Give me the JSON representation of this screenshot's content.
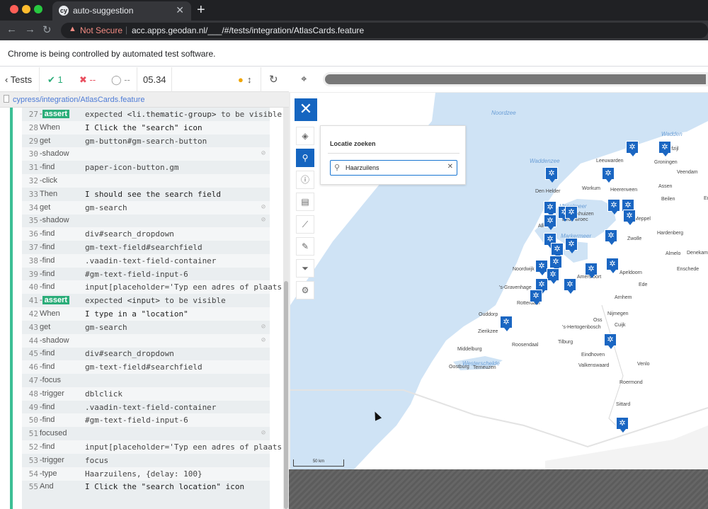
{
  "browser": {
    "tab_title": "auto-suggestion",
    "tab_favicon_text": "cy",
    "security_label": "Not Secure",
    "url": "acc.apps.geodan.nl/___/#/tests/integration/AtlasCards.feature",
    "infobar_text": "Chrome is being controlled by automated test software."
  },
  "reporter": {
    "tests_label": "Tests",
    "passed": "1",
    "failed": "--",
    "pending": "--",
    "duration": "05.34",
    "spec_path": "cypress/integration/AtlasCards.feature",
    "commands": [
      {
        "n": "27",
        "kw": "-assert",
        "msg": "expected <li.thematic-group> to be visible",
        "assert": true,
        "pre": "expected ",
        "el": "<li.thematic-group>",
        "post": " to be ",
        "state": "visible"
      },
      {
        "n": "28",
        "kw": "When",
        "msg": "I Click the \"search\" icon"
      },
      {
        "n": "29",
        "kw": "get",
        "msg": "gm-button#gm-search-button"
      },
      {
        "n": "30",
        "kw": "-shadow",
        "msg": "",
        "eye": true
      },
      {
        "n": "31",
        "kw": "-find",
        "msg": "paper-icon-button.gm"
      },
      {
        "n": "32",
        "kw": "-click",
        "msg": ""
      },
      {
        "n": "33",
        "kw": "Then",
        "msg": "I should see the search field"
      },
      {
        "n": "34",
        "kw": "get",
        "msg": "gm-search",
        "eye": true
      },
      {
        "n": "35",
        "kw": "-shadow",
        "msg": "",
        "eye": true
      },
      {
        "n": "36",
        "kw": "-find",
        "msg": "div#search_dropdown"
      },
      {
        "n": "37",
        "kw": "-find",
        "msg": "gm-text-field#searchfield"
      },
      {
        "n": "38",
        "kw": "-find",
        "msg": ".vaadin-text-field-container"
      },
      {
        "n": "39",
        "kw": "-find",
        "msg": "#gm-text-field-input-6"
      },
      {
        "n": "40",
        "kw": "-find",
        "msg": "input[placeholder='Typ een adres of plaats']"
      },
      {
        "n": "41",
        "kw": "-assert",
        "msg": "expected <input> to be visible",
        "assert": true,
        "pre": "expected ",
        "el": "<input>",
        "post": " to be ",
        "state": "visible"
      },
      {
        "n": "42",
        "kw": "When",
        "msg": "I type in a \"location\""
      },
      {
        "n": "43",
        "kw": "get",
        "msg": "gm-search",
        "eye": true
      },
      {
        "n": "44",
        "kw": "-shadow",
        "msg": "",
        "eye": true
      },
      {
        "n": "45",
        "kw": "-find",
        "msg": "div#search_dropdown"
      },
      {
        "n": "46",
        "kw": "-find",
        "msg": "gm-text-field#searchfield"
      },
      {
        "n": "47",
        "kw": "-focus",
        "msg": ""
      },
      {
        "n": "48",
        "kw": "-trigger",
        "msg": "dblclick"
      },
      {
        "n": "49",
        "kw": "-find",
        "msg": ".vaadin-text-field-container"
      },
      {
        "n": "50",
        "kw": "-find",
        "msg": "#gm-text-field-input-6"
      },
      {
        "n": "51",
        "kw": "focused",
        "msg": "",
        "eye": true
      },
      {
        "n": "52",
        "kw": "-find",
        "msg": "input[placeholder='Typ een adres of plaats']"
      },
      {
        "n": "53",
        "kw": "-trigger",
        "msg": "focus"
      },
      {
        "n": "54",
        "kw": "-type",
        "msg": "Haarzuilens, {delay: 100}"
      },
      {
        "n": "55",
        "kw": "And",
        "msg": "I Click the \"search location\" icon"
      }
    ]
  },
  "map": {
    "search_title": "Locatie zoeken",
    "search_value": "Haarzuilens",
    "scale_label": "50 km",
    "labels": [
      {
        "t": "Noordzee",
        "sea": true
      },
      {
        "t": "Waddenzee",
        "sea": true
      },
      {
        "t": "IJsselmeer",
        "sea": true
      },
      {
        "t": "Markermeer",
        "sea": true
      },
      {
        "t": "Westerschelde",
        "sea": true
      },
      {
        "t": "Wadden",
        "sea": true
      },
      {
        "t": "Leeuwarden"
      },
      {
        "t": "Groningen"
      },
      {
        "t": "Delfzijl"
      },
      {
        "t": "Veendam"
      },
      {
        "t": "Den Helder"
      },
      {
        "t": "Workum"
      },
      {
        "t": "Heerenveen"
      },
      {
        "t": "Assen"
      },
      {
        "t": "Emmen"
      },
      {
        "t": "Beilen"
      },
      {
        "t": "Meppel"
      },
      {
        "t": "Zwolle"
      },
      {
        "t": "Hardenberg"
      },
      {
        "t": "Almelo"
      },
      {
        "t": "Enschede"
      },
      {
        "t": "Denekamp"
      },
      {
        "t": "Apeldoorn"
      },
      {
        "t": "Arnhem"
      },
      {
        "t": "Nijmegen"
      },
      {
        "t": "Amersfoort"
      },
      {
        "t": "Noordwijk"
      },
      {
        "t": "'s-Gravenhage"
      },
      {
        "t": "Rotterdam"
      },
      {
        "t": "Ouddorp"
      },
      {
        "t": "Zierikzee"
      },
      {
        "t": "Roosendaal"
      },
      {
        "t": "Tilburg"
      },
      {
        "t": "Oss"
      },
      {
        "t": "'s-Hertogenbosch"
      },
      {
        "t": "Cuijk"
      },
      {
        "t": "Eindhoven"
      },
      {
        "t": "Venlo"
      },
      {
        "t": "Valkenswaard"
      },
      {
        "t": "Roermond"
      },
      {
        "t": "Sittard"
      },
      {
        "t": "Middelburg"
      },
      {
        "t": "Oostburg"
      },
      {
        "t": "Terneuzen"
      },
      {
        "t": "Ede"
      },
      {
        "t": "Alkmaar"
      },
      {
        "t": "Enkhuizen"
      },
      {
        "t": "Bede Broec"
      }
    ]
  },
  "colors": {
    "accent": "#1565c0",
    "pass": "#2bad79",
    "fail": "#e94f5f",
    "sea": "#cfe3f5"
  }
}
